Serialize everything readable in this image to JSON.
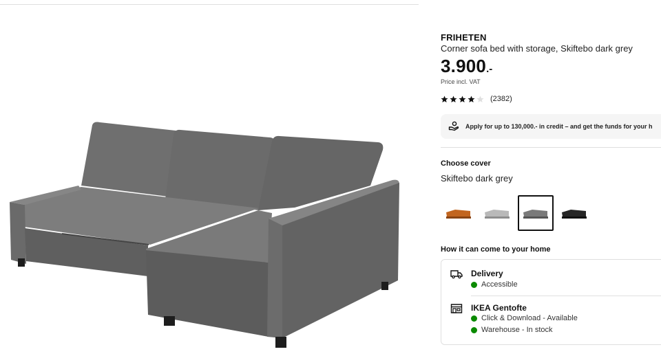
{
  "product": {
    "name": "FRIHETEN",
    "description": "Corner sofa bed with storage, Skiftebo dark grey",
    "price": "3.900",
    "price_suffix": ".-",
    "price_note": "Price incl. VAT",
    "rating": {
      "stars_filled": 4,
      "stars_total": 5,
      "count": "(2382)"
    }
  },
  "credit_banner": {
    "icon": "hand-coin-icon",
    "text": "Apply for up to 130,000.- in credit – and get the funds for your h"
  },
  "cover": {
    "heading": "Choose cover",
    "selected_label": "Skiftebo dark grey",
    "swatches": [
      {
        "name": "orange-brown",
        "color": "#c2651f",
        "selected": false
      },
      {
        "name": "light-grey",
        "color": "#b9b9b9",
        "selected": false
      },
      {
        "name": "dark-grey",
        "color": "#7a7a7a",
        "selected": true
      },
      {
        "name": "black",
        "color": "#262626",
        "selected": false
      }
    ]
  },
  "delivery": {
    "heading": "How it can come to your home",
    "options": [
      {
        "icon": "truck-icon",
        "title": "Delivery",
        "statuses": [
          "Accessible"
        ]
      },
      {
        "icon": "store-icon",
        "title": "IKEA Gentofte",
        "statuses": [
          "Click & Download - Available",
          "Warehouse - In stock"
        ]
      }
    ]
  },
  "colors": {
    "status_green": "#0a8a00",
    "sofa_fabric": "#6e6e6e"
  }
}
